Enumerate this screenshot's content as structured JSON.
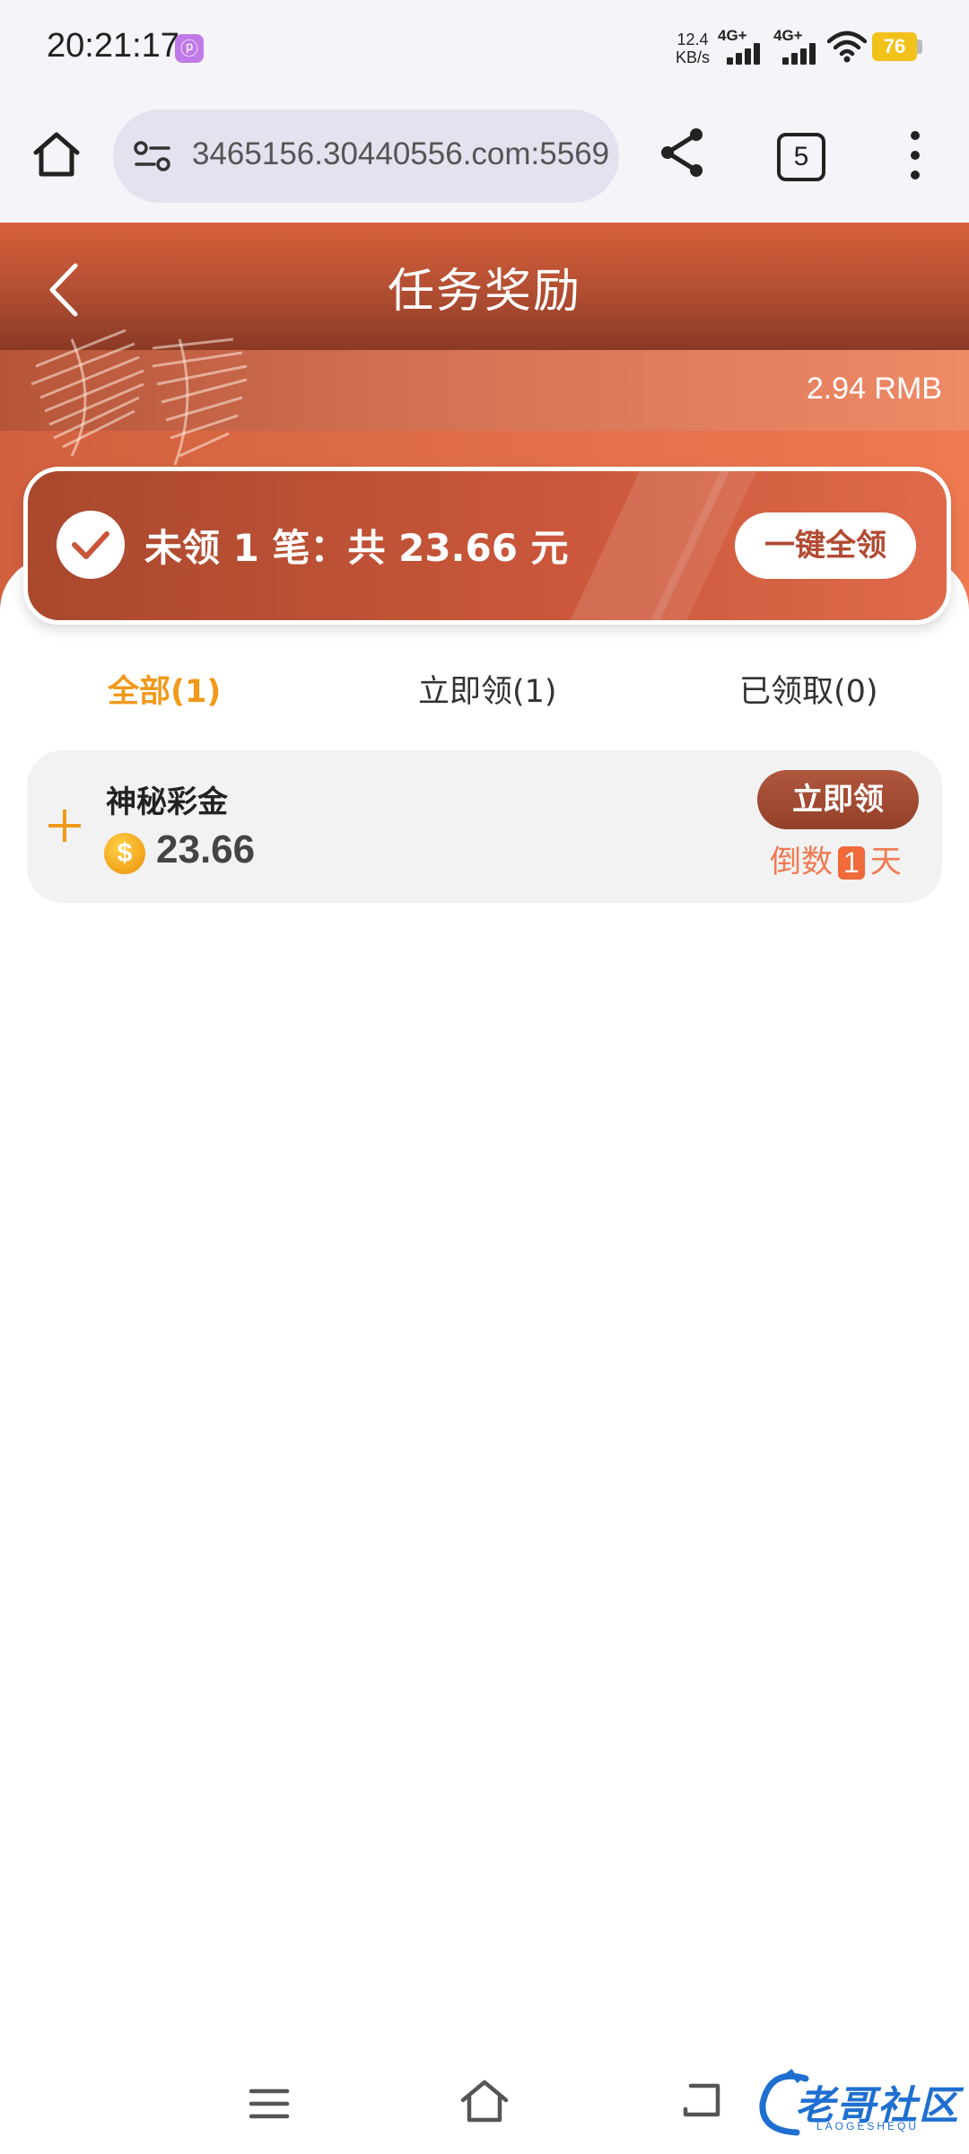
{
  "status_bar": {
    "time": "20:21:17",
    "app_icon": "ⓟ",
    "net_speed_value": "12.4",
    "net_speed_unit": "KB/s",
    "sim1_label": "4G+",
    "sim2_label": "4G+",
    "battery": "76"
  },
  "browser": {
    "url": "3465156.30440556.com:5569",
    "tab_count": "5"
  },
  "header": {
    "title": "任务奖励",
    "balance": "2.94 RMB"
  },
  "summary": {
    "text": "未领 1 笔：共 23.66 元",
    "claim_all_label": "一键全领"
  },
  "tabs": [
    {
      "label": "全部(1)",
      "active": true
    },
    {
      "label": "立即领(1)",
      "active": false
    },
    {
      "label": "已领取(0)",
      "active": false
    }
  ],
  "rewards": [
    {
      "name": "神秘彩金",
      "amount": "23.66",
      "claim_label": "立即领",
      "countdown_prefix": "倒数",
      "countdown_value": "1",
      "countdown_suffix": "天"
    }
  ],
  "watermark": {
    "text": "老哥社区",
    "sub": "LAOGESHEQU"
  },
  "colors": {
    "accent_orange": "#f0991b",
    "header_red": "#c4502f",
    "countdown": "#f07a52",
    "watermark_blue": "#1f6fd1"
  }
}
